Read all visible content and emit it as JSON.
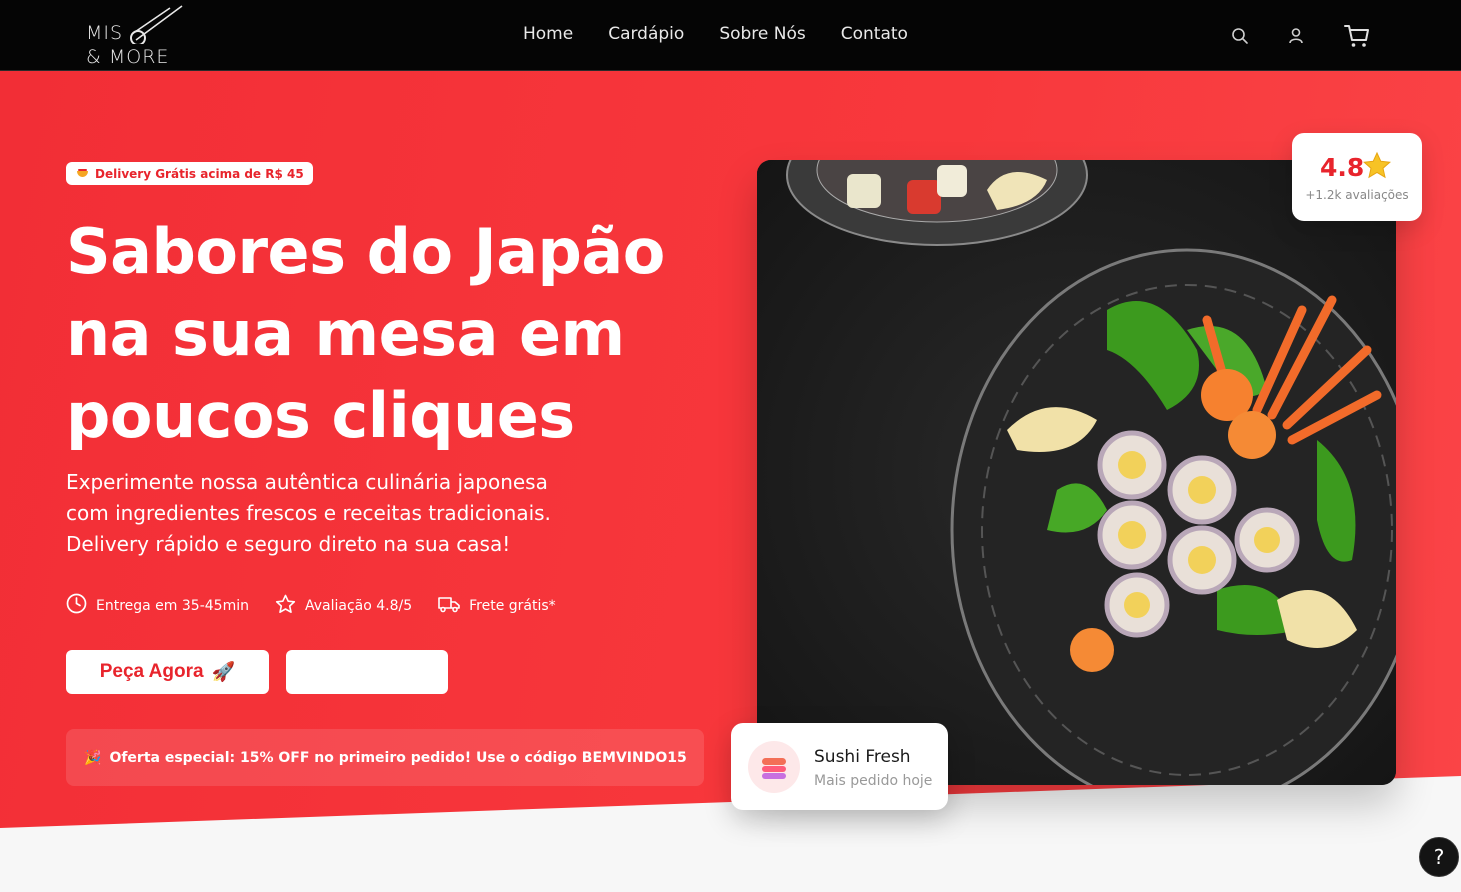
{
  "brand": {
    "line1": "MIS",
    "line2": "& MORE"
  },
  "nav": {
    "links": [
      "Home",
      "Cardápio",
      "Sobre Nós",
      "Contato"
    ],
    "icons": [
      "search-icon",
      "user-icon",
      "cart-icon"
    ]
  },
  "hero": {
    "promo_pill": "Delivery Grátis acima de R$ 45",
    "title": "Sabores do Japão na sua mesa em poucos cliques",
    "subtitle": "Experimente nossa autêntica culinária japonesa com ingredientes frescos e receitas tradicionais. Delivery rápido e seguro direto na sua casa!",
    "features": [
      {
        "icon": "clock-icon",
        "label": "Entrega em 35-45min"
      },
      {
        "icon": "star-icon",
        "label": "Avaliação 4.8/5"
      },
      {
        "icon": "truck-icon",
        "label": "Frete grátis*"
      }
    ],
    "primary_button": "Peça Agora",
    "primary_button_emoji": "🚀",
    "secondary_button": "",
    "offer_text": "Oferta especial: 15% OFF no primeiro pedido! Use o código BEMVINDO15",
    "offer_emoji": "🎉"
  },
  "rating": {
    "value": "4.8",
    "count": "+1.2k avaliações"
  },
  "featured": {
    "title": "Sushi Fresh",
    "subtitle": "Mais pedido hoje"
  },
  "help": {
    "label": "?"
  },
  "colors": {
    "accent": "#f5353a",
    "navbar": "#050505",
    "white": "#ffffff"
  }
}
